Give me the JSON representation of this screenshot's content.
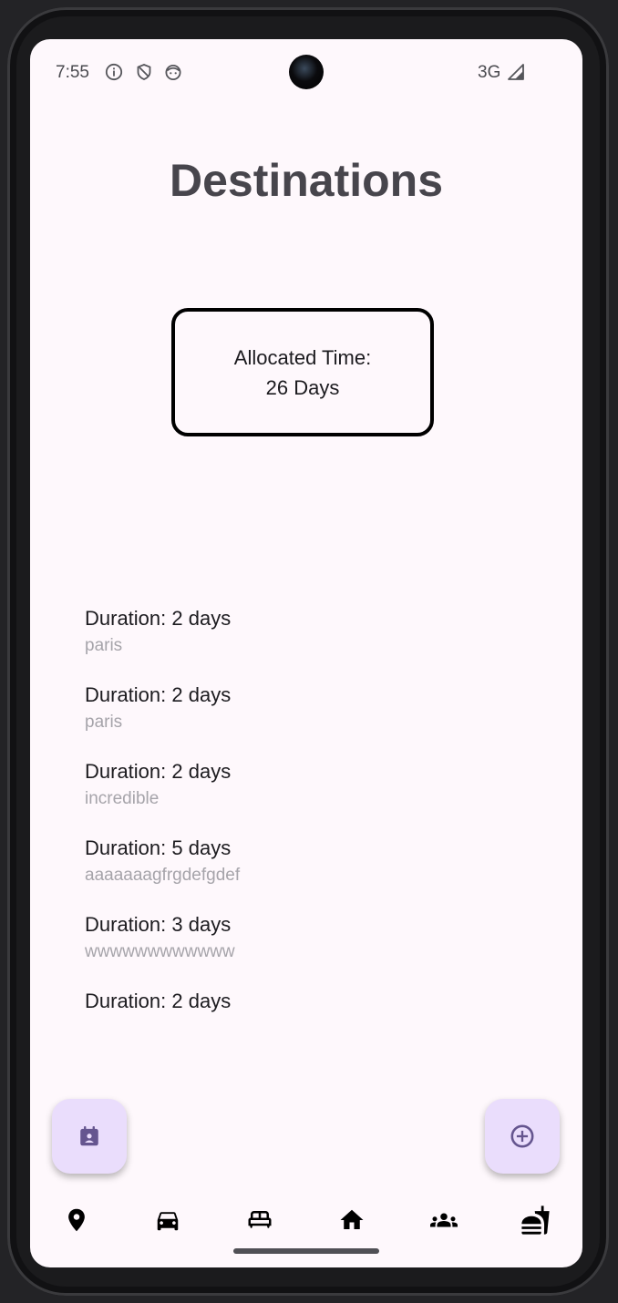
{
  "status_bar": {
    "time": "7:55",
    "icons": [
      "info-icon",
      "shield-icon",
      "android-face-icon"
    ],
    "network": "3G",
    "signal_icon": "signal-icon"
  },
  "header": {
    "title": "Destinations"
  },
  "allocated": {
    "label": "Allocated Time:",
    "value": "26 Days"
  },
  "destinations": [
    {
      "duration": "Duration: 2 days",
      "name": "paris"
    },
    {
      "duration": "Duration: 2 days",
      "name": "paris"
    },
    {
      "duration": "Duration: 2 days",
      "name": "incredible"
    },
    {
      "duration": "Duration: 5 days",
      "name": "aaaaaaagfrgdefgdef"
    },
    {
      "duration": "Duration: 3 days",
      "name": "wwwwwwwwwwww"
    },
    {
      "duration": "Duration: 2 days",
      "name": ""
    }
  ],
  "fabs": {
    "left_icon": "calendar-person-icon",
    "right_icon": "add-circle-icon"
  },
  "bottom_nav": {
    "items": [
      "location-pin-icon",
      "car-icon",
      "bed-icon",
      "home-icon",
      "group-icon",
      "food-icon"
    ]
  },
  "colors": {
    "background": "#fef8fc",
    "title": "#47454c",
    "fab_bg": "#eaddfc",
    "fab_icon": "#65558f",
    "subtext": "#a6a4aa"
  }
}
